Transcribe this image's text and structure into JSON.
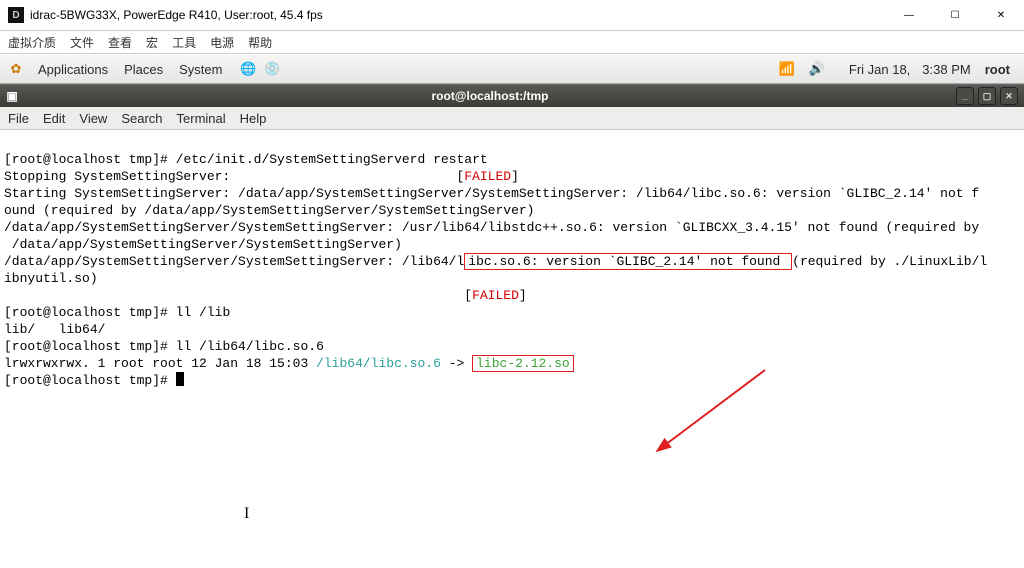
{
  "window": {
    "title": "idrac-5BWG33X, PowerEdge R410, User:root, 45.4 fps",
    "icon_letter": "D"
  },
  "win_controls": {
    "min": "—",
    "max": "☐",
    "close": "✕"
  },
  "cn_menu": [
    "虚拟介质",
    "文件",
    "查看",
    "宏",
    "工具",
    "电源",
    "帮助"
  ],
  "gnome": {
    "apps_icon": "✿",
    "applications": "Applications",
    "places": "Places",
    "system": "System",
    "globe_icon": "🌐",
    "disk_icon": "💿",
    "net_icon": "📶",
    "sound_icon": "🔊",
    "date": "Fri Jan 18,",
    "time": "3:38 PM",
    "user": "root"
  },
  "term_title": "root@localhost:/tmp",
  "term_controls": {
    "min": "_",
    "max": "▢",
    "close": "✕"
  },
  "term_menu": {
    "file": "File",
    "edit": "Edit",
    "view": "View",
    "search": "Search",
    "terminal": "Terminal",
    "help": "Help"
  },
  "lines": {
    "l1_prompt": "[root@localhost tmp]# ",
    "l1_cmd": "/etc/init.d/SystemSettingServerd restart",
    "l2a": "Stopping SystemSettingServer:                             [",
    "l2b": "FAILED",
    "l2c": "]",
    "l3": "Starting SystemSettingServer: /data/app/SystemSettingServer/SystemSettingServer: /lib64/libc.so.6: version `GLIBC_2.14' not f",
    "l4": "ound (required by /data/app/SystemSettingServer/SystemSettingServer)",
    "l5": "/data/app/SystemSettingServer/SystemSettingServer: /usr/lib64/libstdc++.so.6: version `GLIBCXX_3.4.15' not found (required by",
    "l6": " /data/app/SystemSettingServer/SystemSettingServer)",
    "l7a": "/data/app/SystemSettingServer/SystemSettingServer: /lib64/l",
    "l7b": "ibc.so.6: version `GLIBC_2.14' not found ",
    "l7c": "(required by ./LinuxLib/l",
    "l8": "ibnyutil.so)",
    "l9a": "                                                           [",
    "l9b": "FAILED",
    "l9c": "]",
    "l10_prompt": "[root@localhost tmp]# ",
    "l10_cmd": "ll /lib",
    "l11": "lib/   lib64/",
    "l12_prompt": "[root@localhost tmp]# ",
    "l12_cmd": "ll /lib64/libc.so.6",
    "l13a": "lrwxrwxrwx. 1 root root 12 Jan 18 15:03 ",
    "l13b": "/lib64/libc.so.6",
    "l13c": " -> ",
    "l13d": "libc-2.12.so",
    "l14_prompt": "[root@localhost tmp]# "
  },
  "ibeam": "I"
}
